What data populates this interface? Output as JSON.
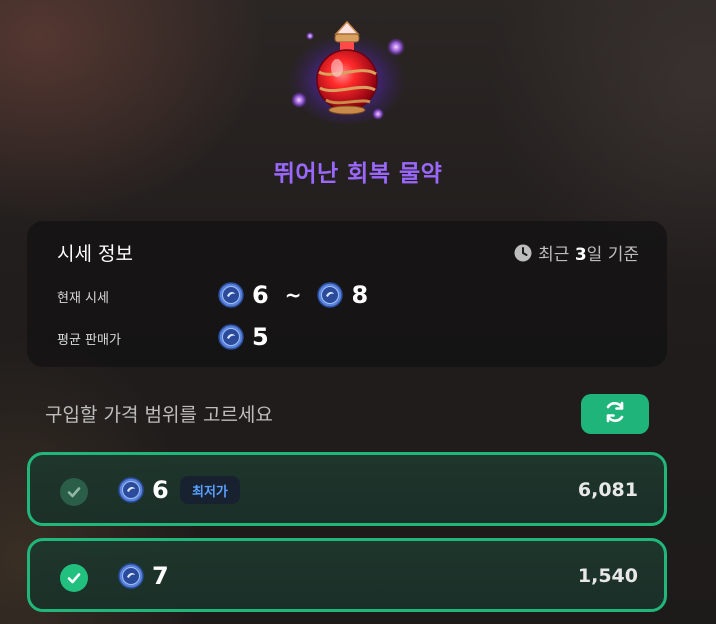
{
  "item": {
    "name": "뛰어난 회복 물약",
    "name_color": "#9a68ff",
    "icon": "red-potion-icon"
  },
  "market_info": {
    "title": "시세 정보",
    "basis_prefix": "최근 ",
    "basis_days": "3",
    "basis_suffix": "일 기준",
    "current_label": "현재 시세",
    "current_min": "6",
    "range_separator": "~",
    "current_max": "8",
    "avg_label": "평균 판매가",
    "avg_value": "5",
    "currency_icon": "blue-coin-icon"
  },
  "selection": {
    "prompt": "구입할 가격 범위를 고르세요",
    "refresh_icon": "refresh-icon",
    "accent_color": "#21b67a",
    "options": [
      {
        "price": "6",
        "badge": "최저가",
        "count": "6,081",
        "checked_style": "muted"
      },
      {
        "price": "7",
        "badge": "",
        "count": "1,540",
        "checked_style": "active"
      }
    ]
  }
}
